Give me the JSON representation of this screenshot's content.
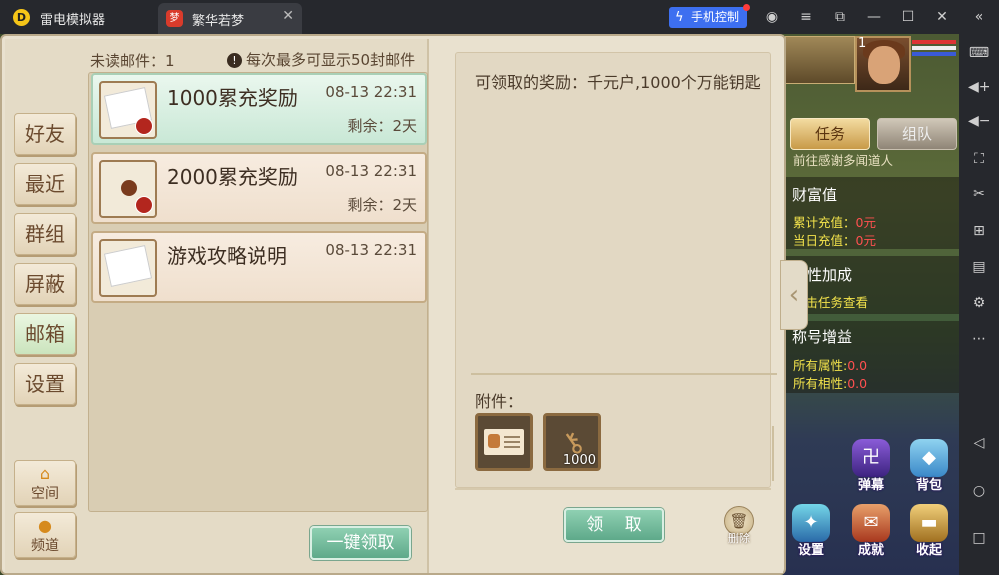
{
  "titlebar": {
    "app_title": "雷电模拟器",
    "tab_title": "繁华若梦",
    "phone_control": "手机控制"
  },
  "nav": {
    "items": [
      "好友",
      "最近",
      "群组",
      "屏蔽",
      "邮箱",
      "设置"
    ],
    "active": "邮箱",
    "space": "空间",
    "channel": "频道"
  },
  "mailbox": {
    "unread_label": "未读邮件：1",
    "max_note": "每次最多可显示50封邮件",
    "mails": [
      {
        "subject": "1000累充奖励",
        "time": "08-13 22:31",
        "remain": "剩余：2天",
        "selected": true
      },
      {
        "subject": "2000累充奖励",
        "time": "08-13 22:31",
        "remain": "剩余：2天",
        "selected": false
      },
      {
        "subject": "游戏攻略说明",
        "time": "08-13 22:31",
        "remain": "",
        "selected": false
      }
    ],
    "claim_all": "一键领取"
  },
  "detail": {
    "reward_text": "可领取的奖励：千元户,1000个万能钥匙",
    "attachments_label": "附件：",
    "attachments": [
      {
        "icon": "title-card-icon",
        "qty": ""
      },
      {
        "icon": "key-icon",
        "qty": "1000"
      }
    ],
    "claim": "领 取",
    "delete": "删除"
  },
  "hud": {
    "level": "1",
    "quest_tab": "任务",
    "team_tab": "组队",
    "npc_line": "前往感谢多闻道人",
    "wealth_title": "财富值",
    "total_recharge": "累计充值：",
    "total_recharge_val": "0元",
    "today_recharge": "当日充值：",
    "today_recharge_val": "0元",
    "attr_title": "属性加成",
    "attr_hint": "点击任务查看",
    "title_title": "称号增益",
    "all_attr": "所有属性:",
    "all_attr_val": "0.0",
    "all_affinity": "所有相性:",
    "all_affinity_val": "0.0",
    "icons": [
      "弹幕",
      "背包",
      "设置",
      "成就",
      "收起"
    ]
  },
  "colors": {
    "accent_green": "#6cb596",
    "panel_bg": "#e9e1cf",
    "selected_mail": "#d7efe0",
    "wealth_yellow": "#f2e24b",
    "value_red": "#ff5050"
  }
}
